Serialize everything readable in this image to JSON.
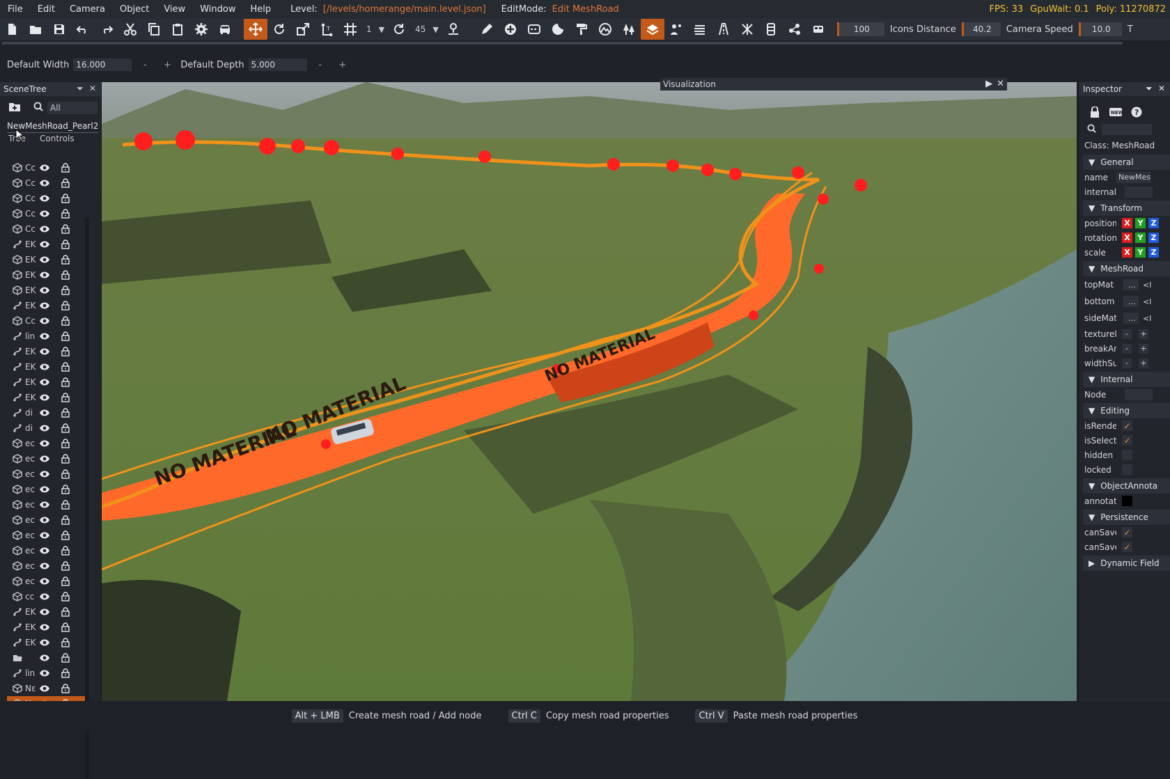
{
  "menubar": {
    "items": [
      "File",
      "Edit",
      "Camera",
      "Object",
      "View",
      "Window",
      "Help"
    ],
    "level_label": "Level:",
    "level_path": "[/levels/homerange/main.level.json]",
    "editmode_label": "EditMode:",
    "editmode_value": "Edit MeshRoad",
    "fps": "FPS: 33",
    "gpuwait": "GpuWait: 0.1",
    "poly": "Poly: 11270872"
  },
  "toolbar": {
    "snap_value": "1",
    "rotate_value": "45",
    "field1": "100",
    "icons_distance_label": "Icons Distance",
    "icons_distance_value": "40.2",
    "camera_speed_label": "Camera Speed",
    "camera_speed_value": "10.0",
    "trailing_label": "T"
  },
  "options": {
    "default_width_label": "Default Width",
    "default_width_value": "16.000",
    "default_depth_label": "Default Depth",
    "default_depth_value": "5.000",
    "minus": "-",
    "plus": "+"
  },
  "scenetree": {
    "title": "SceneTree",
    "filter": "All",
    "selected_object": "NewMeshRoad_Pearl2",
    "tabs": [
      "Tree",
      "Controls"
    ],
    "rows": [
      {
        "icon": "cube",
        "text": "Cc"
      },
      {
        "icon": "cube",
        "text": "Cc"
      },
      {
        "icon": "cube",
        "text": "Cc"
      },
      {
        "icon": "cube",
        "text": "Cc"
      },
      {
        "icon": "cube",
        "text": "Cc"
      },
      {
        "icon": "road",
        "text": "EK"
      },
      {
        "icon": "cube",
        "text": "EK"
      },
      {
        "icon": "cube",
        "text": "EK"
      },
      {
        "icon": "cube",
        "text": "EK"
      },
      {
        "icon": "road",
        "text": "EK"
      },
      {
        "icon": "cube",
        "text": "Cc"
      },
      {
        "icon": "road",
        "text": "lin"
      },
      {
        "icon": "road",
        "text": "EK"
      },
      {
        "icon": "road",
        "text": "EK"
      },
      {
        "icon": "road",
        "text": "EK"
      },
      {
        "icon": "road",
        "text": "EK"
      },
      {
        "icon": "road",
        "text": "di"
      },
      {
        "icon": "road",
        "text": "di"
      },
      {
        "icon": "cube",
        "text": "ec"
      },
      {
        "icon": "cube",
        "text": "ec"
      },
      {
        "icon": "cube",
        "text": "ec"
      },
      {
        "icon": "cube",
        "text": "ec"
      },
      {
        "icon": "cube",
        "text": "ec"
      },
      {
        "icon": "cube",
        "text": "ec"
      },
      {
        "icon": "cube",
        "text": "ec"
      },
      {
        "icon": "cube",
        "text": "ec"
      },
      {
        "icon": "cube",
        "text": "ec"
      },
      {
        "icon": "cube",
        "text": "ec"
      },
      {
        "icon": "cube",
        "text": "cc"
      },
      {
        "icon": "road",
        "text": "EK"
      },
      {
        "icon": "road",
        "text": "EK"
      },
      {
        "icon": "road",
        "text": "EK"
      },
      {
        "icon": "folder",
        "text": ""
      },
      {
        "icon": "road",
        "text": "lin"
      },
      {
        "icon": "cube",
        "text": "Nε"
      },
      {
        "icon": "cube",
        "text": "Nε"
      }
    ]
  },
  "viewport": {
    "visualization_label": "Visualization",
    "road_texture_text": "NO MATERIAL"
  },
  "inspector": {
    "title": "Inspector",
    "class_label": "Class:  MeshRoad",
    "sections": {
      "general": "General",
      "transform": "Transform",
      "meshroad": "MeshRoad",
      "internal": "Internal",
      "editing": "Editing",
      "objectannotation": "ObjectAnnota",
      "persistence": "Persistence",
      "dynamic": "Dynamic Field"
    },
    "props": {
      "name": "name",
      "name_val": "NewMes",
      "internal": "internal",
      "position": "position",
      "rotation": "rotation",
      "scale": "scale",
      "topmat": "topMat",
      "bottommat": "bottom",
      "sidemat": "sideMat",
      "texturel": "texturel",
      "breakan": "breakAr",
      "widthsu": "widthSu",
      "node": "Node",
      "isrender": "isRende",
      "isselect": "isSelect",
      "hidden": "hidden",
      "locked": "locked",
      "annotat": "annotat",
      "cansave1": "canSave",
      "cansave2": "canSave",
      "mat_btn": "...",
      "mat_tag": "<l"
    },
    "axis": [
      "X",
      "Y",
      "Z"
    ],
    "axis_colors": [
      "#d62020",
      "#22a022",
      "#1f5ad8"
    ]
  },
  "statusbar": {
    "hints": [
      {
        "key": "Alt + LMB",
        "desc": "Create mesh road / Add node"
      },
      {
        "key": "Ctrl C",
        "desc": "Copy mesh road properties"
      },
      {
        "key": "Ctrl V",
        "desc": "Paste mesh road properties"
      }
    ]
  },
  "colors": {
    "accent": "#c45a1a",
    "road_orange": "#ff6a2a",
    "spline": "#f0921a",
    "node_red": "#ff1e1e",
    "terrain": "#5b6e3c",
    "water": "#6f8a86"
  }
}
